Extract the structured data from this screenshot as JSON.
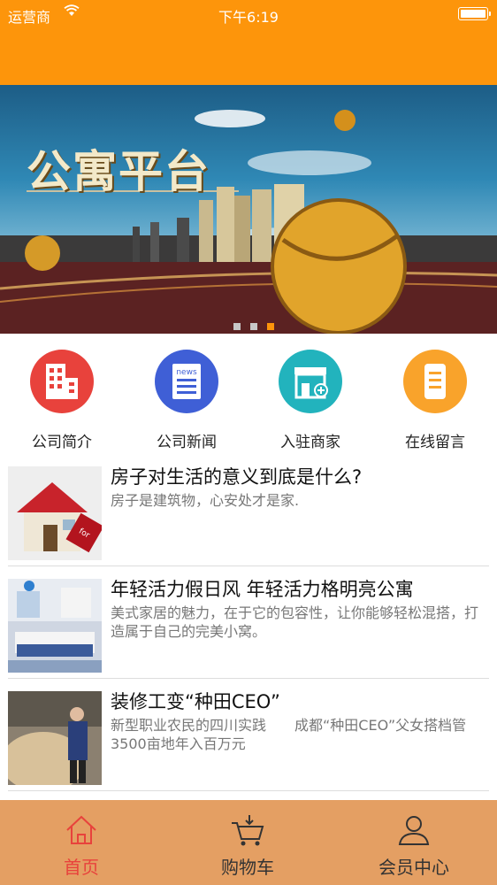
{
  "status_bar": {
    "carrier": "运营商",
    "time": "下午6:19"
  },
  "banner": {
    "title": "公寓平台",
    "slides": 3,
    "active_slide": 3
  },
  "quick_links": [
    {
      "label": "公司简介",
      "icon": "buildings-icon",
      "color": "#e8423c"
    },
    {
      "label": "公司新闻",
      "icon": "news-icon",
      "color": "#3f5fd6"
    },
    {
      "label": "入驻商家",
      "icon": "store-icon",
      "color": "#22b3bd"
    },
    {
      "label": "在线留言",
      "icon": "message-icon",
      "color": "#f9a32b"
    }
  ],
  "articles": [
    {
      "title": "房子对生活的意义到底是什么?",
      "desc": "房子是建筑物，心安处才是家."
    },
    {
      "title": "年轻活力假日风 年轻活力格明亮公寓",
      "desc": "美式家居的魅力，在于它的包容性，让你能够轻松混搭，打造属于自己的完美小窝。"
    },
    {
      "title": "装修工变“种田CEO”",
      "desc": "新型职业农民的四川实践　　成都“种田CEO”父女搭档管3500亩地年入百万元"
    }
  ],
  "tabbar": [
    {
      "label": "首页",
      "icon": "home-icon",
      "active": true
    },
    {
      "label": "购物车",
      "icon": "cart-icon",
      "active": false
    },
    {
      "label": "会员中心",
      "icon": "user-icon",
      "active": false
    }
  ],
  "colors": {
    "header": "#fd950b",
    "tabbar": "#e49f63",
    "active_tab": "#e8423c"
  }
}
